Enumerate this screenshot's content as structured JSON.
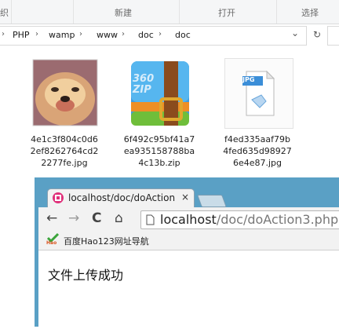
{
  "explorer": {
    "ribbon": {
      "left_partial": "织",
      "new_group": "新建",
      "open_group": "打开",
      "select_group": "选择"
    },
    "address": {
      "crumbs": [
        "PHP",
        "wamp",
        "www",
        "doc",
        "doc"
      ],
      "dropdown_glyph": "⌄",
      "refresh_glyph": "↻"
    },
    "files": [
      {
        "name": "4e1c3f804c0d6\n2ef8262764cd2\n2277fe.jpg",
        "kind": "image"
      },
      {
        "name": "6f492c95bf41a7\nea935158788ba\n4c13b.zip",
        "kind": "zip-archive",
        "badge_text": "360\nZIP"
      },
      {
        "name": "f4ed335aaf79b\n4fed635d98927\n6e4e87.jpg",
        "kind": "jpg-document",
        "badge_text": "JPG"
      }
    ]
  },
  "browser": {
    "tab": {
      "title": "localhost/doc/doAction",
      "close": "×"
    },
    "nav": {
      "back": "←",
      "forward": "→",
      "reload": "C",
      "home": "⌂"
    },
    "url": {
      "host": "localhost",
      "path": "/doc/doAction3.php"
    },
    "bookmark": {
      "label": "百度Hao123网址导航",
      "icon_text": "Hao"
    },
    "page": {
      "message": "文件上传成功"
    }
  },
  "colors": {
    "browser_frame": "#5aa0c5",
    "tab_icon": "#e0307a"
  }
}
